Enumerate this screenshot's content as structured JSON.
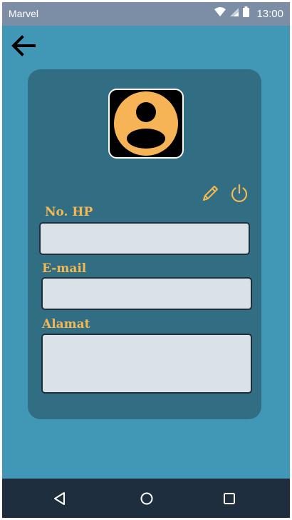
{
  "status_bar": {
    "carrier": "Marvel",
    "time": "13:00",
    "icons": [
      "wifi-icon",
      "signal-icon",
      "battery-icon"
    ]
  },
  "toolbar": {
    "back_icon": "arrow-left-icon"
  },
  "profile": {
    "avatar_icon": "user-avatar-icon",
    "actions": [
      "pencil-edit-icon",
      "power-icon"
    ],
    "fields": {
      "phone": {
        "label": "No. HP",
        "value": ""
      },
      "email": {
        "label": "E-mail",
        "value": ""
      },
      "address": {
        "label": "Alamat",
        "value": ""
      }
    }
  },
  "nav_bar": {
    "icons": [
      "back-triangle-icon",
      "home-circle-icon",
      "recents-square-icon"
    ]
  },
  "colors": {
    "background": "#4098b6",
    "card": "#316e84",
    "accent": "#f5b851",
    "field": "#d8e2e7",
    "status_bar": "#7c8ea5",
    "nav_bar": "#1f2e3f"
  }
}
